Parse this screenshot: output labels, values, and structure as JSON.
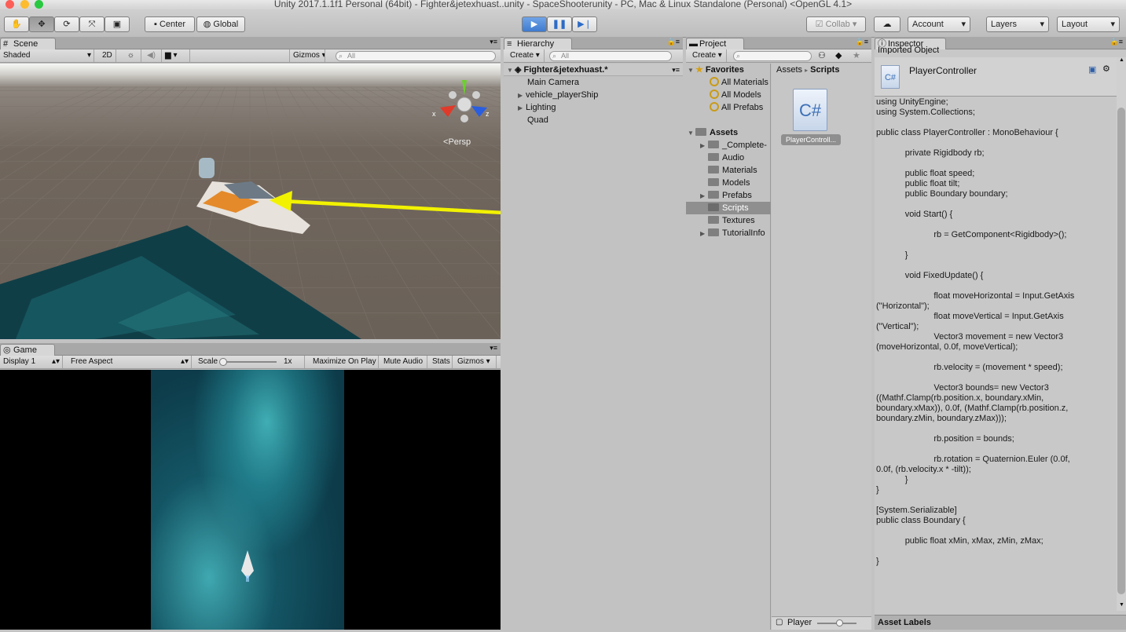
{
  "window_title": "Unity 2017.1.1f1 Personal (64bit) - Fighter&jetexhuast..unity - SpaceShooterunity - PC, Mac & Linux Standalone (Personal) <OpenGL 4.1>",
  "toolbar": {
    "center": "Center",
    "global": "Global",
    "collab": "Collab",
    "account": "Account",
    "layers": "Layers",
    "layout": "Layout"
  },
  "scene": {
    "tab": "Scene",
    "shading": "Shaded",
    "mode_2d": "2D",
    "gizmos": "Gizmos",
    "search": "All",
    "persp": "Persp",
    "axis_x": "x",
    "axis_z": "z"
  },
  "game": {
    "tab": "Game",
    "display": "Display 1",
    "aspect": "Free Aspect",
    "scale_label": "Scale",
    "scale_value": "1x",
    "maximize": "Maximize On Play",
    "mute": "Mute Audio",
    "stats": "Stats",
    "gizmos": "Gizmos"
  },
  "hierarchy": {
    "tab": "Hierarchy",
    "create": "Create",
    "search": "All",
    "scene_name": "Fighter&jetexhuast.*",
    "items": [
      "Main Camera",
      "vehicle_playerShip",
      "Lighting",
      "Quad"
    ]
  },
  "project": {
    "tab": "Project",
    "create": "Create",
    "favorites": "Favorites",
    "fav_items": [
      "All Materials",
      "All Models",
      "All Prefabs"
    ],
    "assets": "Assets",
    "folders": [
      "_Complete-",
      "Audio",
      "Materials",
      "Models",
      "Prefabs",
      "Scripts",
      "Textures",
      "TutorialInfo"
    ],
    "breadcrumb": [
      "Assets",
      "Scripts"
    ],
    "file_name": "PlayerControll...",
    "file_icon": "C#",
    "footer": "Player"
  },
  "inspector": {
    "tab": "Inspector",
    "header_cut": "Imported Object",
    "title": "PlayerController",
    "icon": "C#",
    "asset_labels": "Asset Labels",
    "code": "using UnityEngine;\nusing System.Collections;\n\npublic class PlayerController : MonoBehaviour {\n\n            private Rigidbody rb;\n\n            public float speed;\n            public float tilt;\n            public Boundary boundary;\n\n            void Start() {\n\n                        rb = GetComponent<Rigidbody>();\n\n            }\n\n            void FixedUpdate() {\n\n                        float moveHorizontal = Input.GetAxis\n(\"Horizontal\");\n                        float moveVertical = Input.GetAxis\n(\"Vertical\");\n                        Vector3 movement = new Vector3\n(moveHorizontal, 0.0f, moveVertical);\n\n                        rb.velocity = (movement * speed);\n\n                        Vector3 bounds= new Vector3\n((Mathf.Clamp(rb.position.x, boundary.xMin,\nboundary.xMax)), 0.0f, (Mathf.Clamp(rb.position.z,\nboundary.zMin, boundary.zMax)));\n\n                        rb.position = bounds;\n\n                        rb.rotation = Quaternion.Euler (0.0f,\n0.0f, (rb.velocity.x * -tilt));\n            }\n}\n\n[System.Serializable]\npublic class Boundary {\n\n            public float xMin, xMax, zMin, zMax;\n\n}"
  },
  "colors": {
    "play_blue": "#3e7bd0",
    "annotation_arrow": "#f2f200",
    "selection": "#8f8f8f"
  }
}
